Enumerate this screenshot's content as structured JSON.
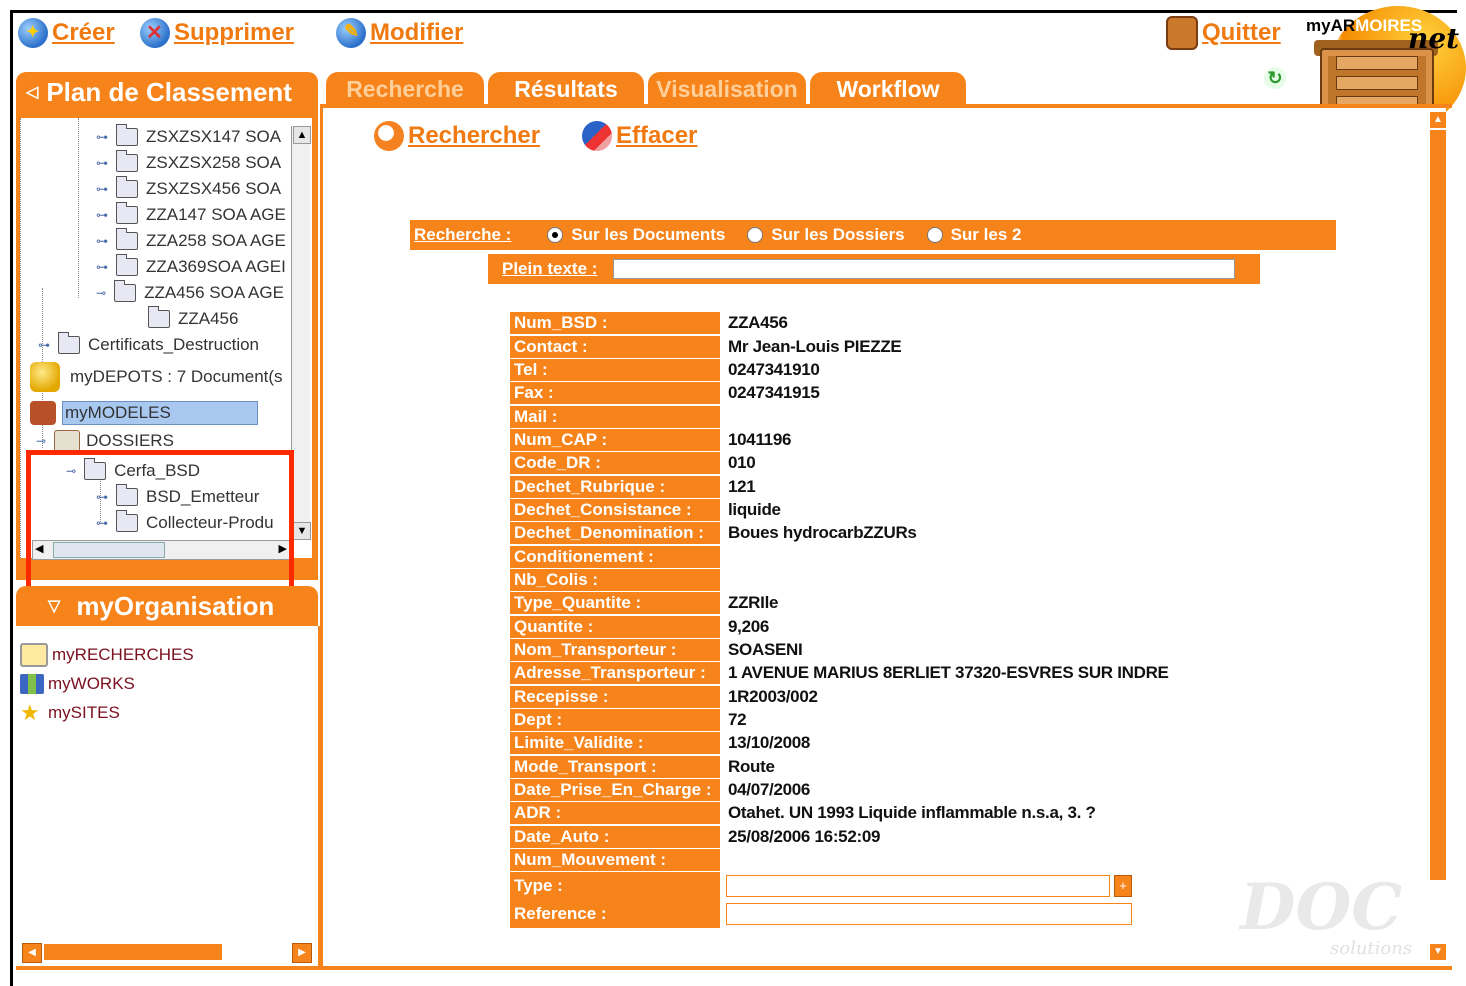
{
  "toolbar": {
    "create_label": "Créer",
    "delete_label": "Supprimer",
    "edit_label": "Modifier",
    "quit_label": "Quitter"
  },
  "logo": {
    "brand_prefix": "myAR",
    "brand_suffix": "MOIRES",
    "net": "net"
  },
  "left_panel": {
    "title": "Plan de Classement",
    "tree": [
      {
        "label": "ZSXZSX147 SOA"
      },
      {
        "label": "ZSXZSX258 SOA"
      },
      {
        "label": "ZSXZSX456 SOA"
      },
      {
        "label": "ZZA147 SOA AGE"
      },
      {
        "label": "ZZA258 SOA AGE"
      },
      {
        "label": "ZZA369SOA AGEI"
      },
      {
        "label": "ZZA456 SOA AGE"
      },
      {
        "label": "ZZA456"
      },
      {
        "label": "Certificats_Destruction"
      },
      {
        "label": "myDEPOTS : 7 Document(s"
      },
      {
        "label": "myMODELES"
      },
      {
        "label": "DOSSIERS"
      },
      {
        "label": "Cerfa_BSD"
      },
      {
        "label": "BSD_Emetteur"
      },
      {
        "label": "Collecteur-Produ"
      }
    ]
  },
  "org_panel": {
    "title": "myOrganisation",
    "items": [
      {
        "label": "myRECHERCHES",
        "icon": "search-folder-icon"
      },
      {
        "label": "myWORKS",
        "icon": "books-icon"
      },
      {
        "label": "mySITES",
        "icon": "star-icon"
      }
    ]
  },
  "tabs": [
    {
      "label": "Recherche",
      "active": false
    },
    {
      "label": "Résultats",
      "active": true
    },
    {
      "label": "Visualisation",
      "active": false
    },
    {
      "label": "Workflow",
      "active": true
    }
  ],
  "actions": {
    "search_label": "Rechercher",
    "clear_label": "Effacer"
  },
  "search": {
    "label": "Recherche :",
    "options": [
      {
        "label": "Sur les Documents",
        "selected": true
      },
      {
        "label": "Sur les Dossiers",
        "selected": false
      },
      {
        "label": "Sur les 2",
        "selected": false
      }
    ],
    "fulltext_label": "Plein texte :",
    "fulltext_value": ""
  },
  "fields": [
    {
      "label": "Num_BSD :",
      "value": "ZZA456"
    },
    {
      "label": "Contact :",
      "value": "Mr Jean-Louis PIEZZE"
    },
    {
      "label": "Tel :",
      "value": "0247341910"
    },
    {
      "label": "Fax :",
      "value": "0247341915"
    },
    {
      "label": "Mail :",
      "value": ""
    },
    {
      "label": "Num_CAP :",
      "value": "1041196"
    },
    {
      "label": "Code_DR :",
      "value": "010"
    },
    {
      "label": "Dechet_Rubrique :",
      "value": "121"
    },
    {
      "label": "Dechet_Consistance :",
      "value": "liquide"
    },
    {
      "label": "Dechet_Denomination :",
      "value": "Boues hydrocarbZZURs"
    },
    {
      "label": "Conditionement :",
      "value": ""
    },
    {
      "label": "Nb_Colis :",
      "value": ""
    },
    {
      "label": "Type_Quantite :",
      "value": "ZZRIle"
    },
    {
      "label": "Quantite :",
      "value": "9,206"
    },
    {
      "label": "Nom_Transporteur :",
      "value": "SOASENI"
    },
    {
      "label": "Adresse_Transporteur :",
      "value": "1 AVENUE MARIUS 8ERLIET 37320-ESVRES SUR INDRE"
    },
    {
      "label": "Recepisse :",
      "value": "1R2003/002"
    },
    {
      "label": "Dept :",
      "value": "72"
    },
    {
      "label": "Limite_Validite :",
      "value": "13/10/2008"
    },
    {
      "label": "Mode_Transport :",
      "value": "Route"
    },
    {
      "label": "Date_Prise_En_Charge :",
      "value": "04/07/2006"
    },
    {
      "label": "ADR :",
      "value": "Otahet. UN 1993 Liquide inflammable n.s.a, 3. ?"
    },
    {
      "label": "Date_Auto :",
      "value": "25/08/2006 16:52:09"
    },
    {
      "label": "Num_Mouvement :",
      "value": ""
    }
  ],
  "input_fields": [
    {
      "label": "Type :",
      "value": "",
      "has_picker": true
    },
    {
      "label": "Reference :",
      "value": "",
      "has_picker": false
    }
  ],
  "watermark": {
    "text": "DOC",
    "sub": "solutions"
  },
  "colors": {
    "accent": "#f7831b",
    "highlight_box": "#ff2a00",
    "selected_item": "#a8c8f0"
  }
}
